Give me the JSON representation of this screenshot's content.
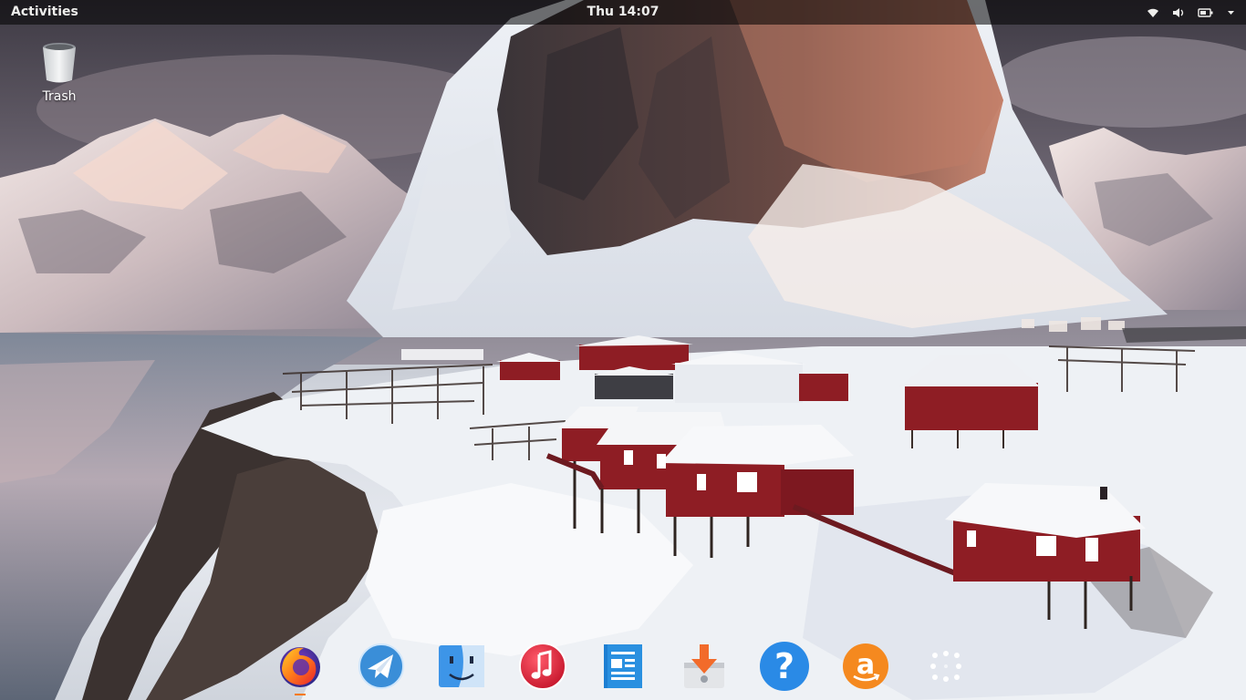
{
  "topbar": {
    "activities_label": "Activities",
    "clock": "Thu 14:07",
    "tray_icons": [
      "wifi-icon",
      "volume-icon",
      "battery-icon",
      "chevron-down-icon"
    ]
  },
  "desktop": {
    "icons": [
      {
        "label": "Trash",
        "icon": "trash-icon"
      }
    ]
  },
  "dock": {
    "items": [
      {
        "name": "firefox",
        "icon": "firefox-icon",
        "running": true
      },
      {
        "name": "mail",
        "icon": "mail-icon",
        "running": false
      },
      {
        "name": "finder",
        "icon": "finder-icon",
        "running": false
      },
      {
        "name": "music",
        "icon": "music-icon",
        "running": false
      },
      {
        "name": "document-viewer",
        "icon": "document-icon",
        "running": false
      },
      {
        "name": "downloader",
        "icon": "download-icon",
        "running": false
      },
      {
        "name": "help",
        "icon": "help-icon",
        "running": false
      },
      {
        "name": "amazon",
        "icon": "amazon-icon",
        "running": false
      },
      {
        "name": "show-applications",
        "icon": "app-grid-icon",
        "running": false
      }
    ]
  },
  "colors": {
    "topbar_bg": "#000000",
    "accent": "#f57900",
    "house_red": "#9b1b24",
    "snow": "#f2f4f7"
  }
}
